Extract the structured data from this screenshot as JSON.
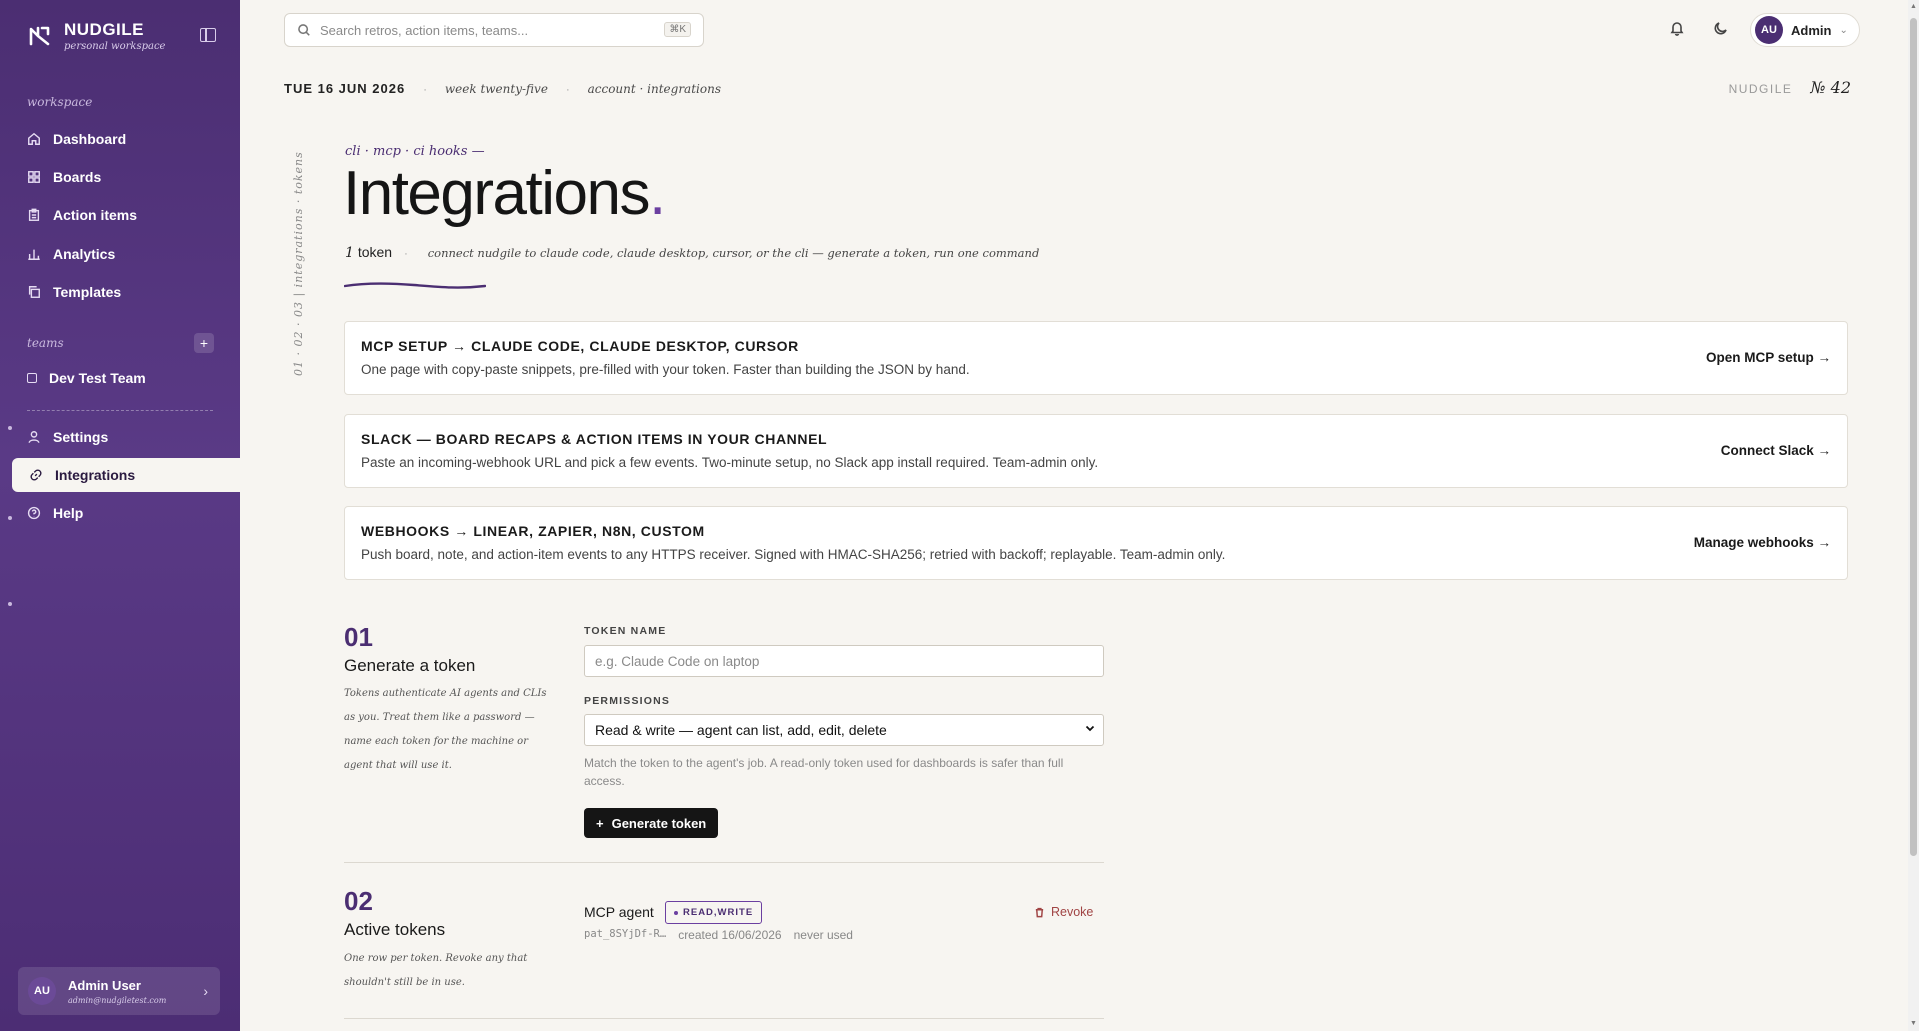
{
  "brand": {
    "name": "NUDGILE",
    "subtitle": "personal workspace"
  },
  "sidebar": {
    "workspace_label": "workspace",
    "items": [
      {
        "label": "Dashboard",
        "icon": "home-icon"
      },
      {
        "label": "Boards",
        "icon": "grid-icon"
      },
      {
        "label": "Action items",
        "icon": "clipboard-icon"
      },
      {
        "label": "Analytics",
        "icon": "bar-chart-icon"
      },
      {
        "label": "Templates",
        "icon": "copy-icon"
      }
    ],
    "teams_label": "teams",
    "team_add": "+",
    "teams": [
      {
        "label": "Dev Test Team"
      }
    ],
    "bottom_items": [
      {
        "label": "Settings",
        "icon": "user-icon"
      },
      {
        "label": "Integrations",
        "icon": "link-icon",
        "active": true
      },
      {
        "label": "Help",
        "icon": "help-circle-icon"
      }
    ],
    "user": {
      "initials": "AU",
      "name": "Admin User",
      "email": "admin@nudgiletest.com"
    }
  },
  "topbar": {
    "search_placeholder": "Search retros, action items, teams...",
    "shortcut": "⌘K",
    "account": {
      "initials": "AU",
      "name": "Admin"
    }
  },
  "header": {
    "date": "TUE 16 JUN 2026",
    "week": "week twenty-five",
    "crumb": "account · integrations",
    "issue_brand": "NUDGILE",
    "issue_number": "№ 42",
    "vertical_label": "01 · 02 · 03  |  integrations · tokens",
    "kicker": "cli · mcp · ci hooks —",
    "title": "Integrations",
    "title_dot": ".",
    "token_count": "1",
    "token_word": "token",
    "description": "connect nudgile to claude code, claude desktop, cursor, or the cli — generate a token, run one command"
  },
  "cards": [
    {
      "title": "MCP SETUP → CLAUDE CODE, CLAUDE DESKTOP, CURSOR",
      "desc": "One page with copy-paste snippets, pre-filled with your token. Faster than building the JSON by hand.",
      "action": "Open MCP setup →"
    },
    {
      "title": "SLACK — BOARD RECAPS & ACTION ITEMS IN YOUR CHANNEL",
      "desc": "Paste an incoming-webhook URL and pick a few events. Two-minute setup, no Slack app install required. Team-admin only.",
      "action": "Connect Slack →"
    },
    {
      "title": "WEBHOOKS → LINEAR, ZAPIER, N8N, CUSTOM",
      "desc": "Push board, note, and action-item events to any HTTPS receiver. Signed with HMAC-SHA256; retried with backoff; replayable. Team-admin only.",
      "action": "Manage webhooks →"
    }
  ],
  "generate": {
    "num": "01",
    "title": "Generate a token",
    "note": "Tokens authenticate AI agents and CLIs as you. Treat them like a password — name each token for the machine or agent that will use it.",
    "name_label": "TOKEN NAME",
    "name_placeholder": "e.g. Claude Code on laptop",
    "name_value": "",
    "perm_label": "PERMISSIONS",
    "perm_value": "Read & write — agent can list, add, edit, delete",
    "help": "Match the token to the agent's job. A read-only token used for dashboards is safer than full access.",
    "button": "Generate token"
  },
  "tokens": {
    "num": "02",
    "title": "Active tokens",
    "note": "One row per token. Revoke any that shouldn't still be in use.",
    "rows": [
      {
        "name": "MCP agent",
        "scope": "READ,WRITE",
        "prefix": "pat_8SYjDf-R…",
        "created": "created 16/06/2026",
        "used": "never used",
        "revoke": "Revoke"
      }
    ]
  }
}
